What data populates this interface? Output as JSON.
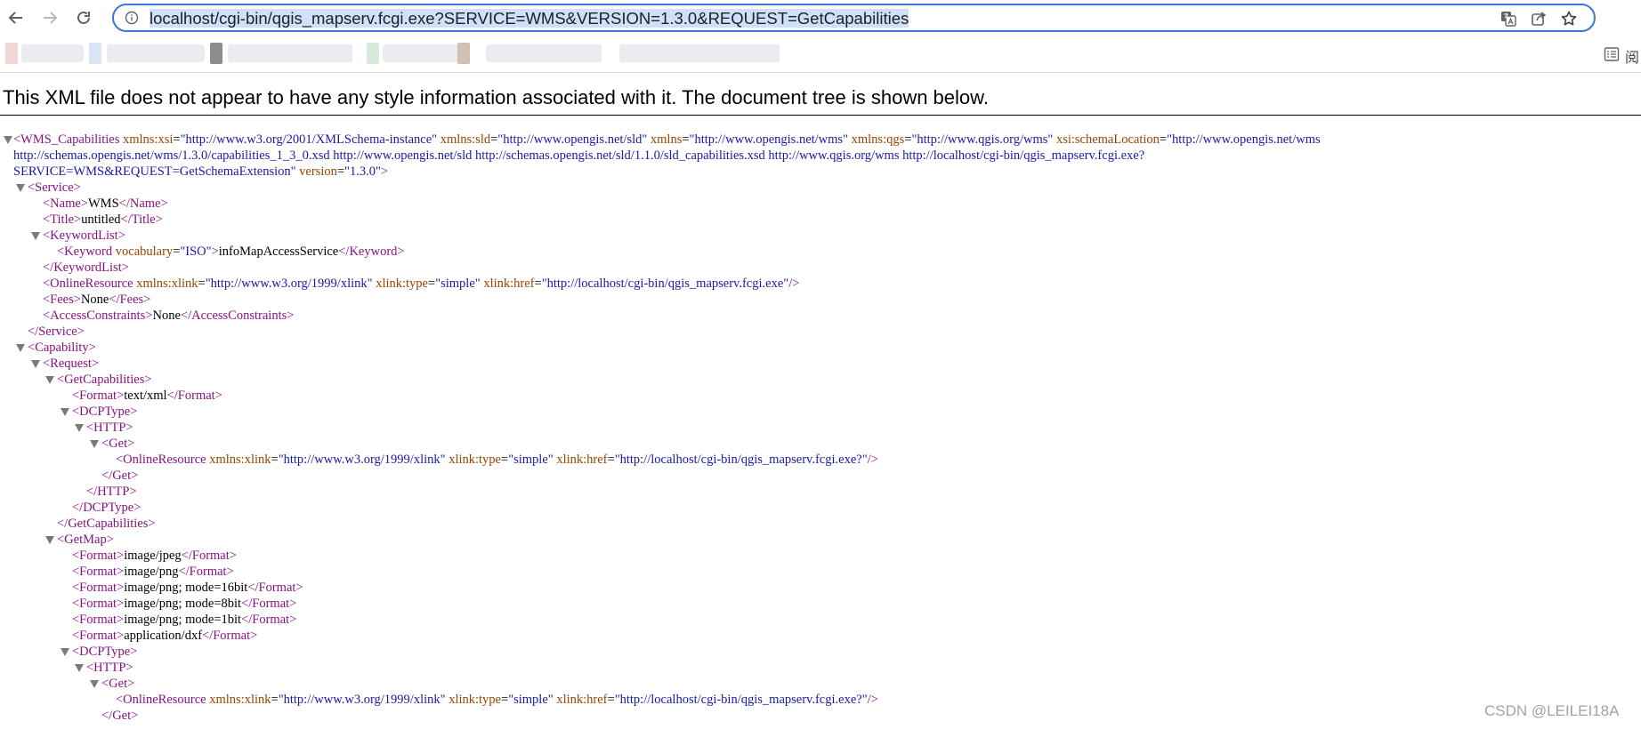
{
  "browser": {
    "url": "localhost/cgi-bin/qgis_mapserv.fcgi.exe?SERVICE=WMS&VERSION=1.3.0&REQUEST=GetCapabilities",
    "reading_list_label": "阅"
  },
  "xml_viewer": {
    "header": "This XML file does not appear to have any style information associated with it. The document tree is shown below.",
    "root_line1": {
      "open": "<WMS_Capabilities",
      "attrs": [
        {
          "n": "xmlns:xsi",
          "v": "\"http://www.w3.org/2001/XMLSchema-instance\""
        },
        {
          "n": "xmlns:sld",
          "v": "\"http://www.opengis.net/sld\""
        },
        {
          "n": "xmlns",
          "v": "\"http://www.opengis.net/wms\""
        },
        {
          "n": "xmlns:qgs",
          "v": "\"http://www.qgis.org/wms\""
        },
        {
          "n": "xsi:schemaLocation",
          "v": "\"http://www.opengis.net/wms"
        }
      ]
    },
    "root_line2": "http://schemas.opengis.net/wms/1.3.0/capabilities_1_3_0.xsd http://www.opengis.net/sld http://schemas.opengis.net/sld/1.1.0/sld_capabilities.xsd http://www.qgis.org/wms http://localhost/cgi-bin/qgis_mapserv.fcgi.exe?",
    "root_line3": {
      "text": "SERVICE=WMS&REQUEST=GetSchemaExtension\"",
      "attr_n": "version",
      "attr_v": "\"1.3.0\"",
      "close": ">"
    },
    "service": {
      "open": "<Service>",
      "close": "</Service>",
      "name": {
        "open": "<Name>",
        "text": "WMS",
        "close": "</Name>"
      },
      "title": {
        "open": "<Title>",
        "text": "untitled",
        "close": "</Title>"
      },
      "keywordlist_open": "<KeywordList>",
      "keyword": {
        "open": "<Keyword",
        "an": "vocabulary",
        "av": "\"ISO\"",
        "gt": ">",
        "text": "infoMapAccessService",
        "close": "</Keyword>"
      },
      "keywordlist_close": "</KeywordList>",
      "online": {
        "open": "<OnlineResource",
        "a1n": "xmlns:xlink",
        "a1v": "\"http://www.w3.org/1999/xlink\"",
        "a2n": "xlink:type",
        "a2v": "\"simple\"",
        "a3n": "xlink:href",
        "a3v": "\"http://localhost/cgi-bin/qgis_mapserv.fcgi.exe\"",
        "close": "/>"
      },
      "fees": {
        "open": "<Fees>",
        "text": "None",
        "close": "</Fees>"
      },
      "access": {
        "open": "<AccessConstraints>",
        "text": "None",
        "close": "</AccessConstraints>"
      }
    },
    "capability": {
      "open": "<Capability>",
      "request_open": "<Request>",
      "getcap_open": "<GetCapabilities>",
      "getcap_format": {
        "open": "<Format>",
        "text": "text/xml",
        "close": "</Format>"
      },
      "dcp_open": "<DCPType>",
      "http_open": "<HTTP>",
      "get_open": "<Get>",
      "online": {
        "open": "<OnlineResource",
        "a1n": "xmlns:xlink",
        "a1v": "\"http://www.w3.org/1999/xlink\"",
        "a2n": "xlink:type",
        "a2v": "\"simple\"",
        "a3n": "xlink:href",
        "a3v": "\"http://localhost/cgi-bin/qgis_mapserv.fcgi.exe?\"",
        "close": "/>"
      },
      "get_close": "</Get>",
      "http_close": "</HTTP>",
      "dcp_close": "</DCPType>",
      "getcap_close": "</GetCapabilities>",
      "getmap_open": "<GetMap>",
      "getmap_formats": [
        "image/jpeg",
        "image/png",
        "image/png; mode=16bit",
        "image/png; mode=8bit",
        "image/png; mode=1bit",
        "application/dxf"
      ],
      "format_open": "<Format>",
      "format_close": "</Format>",
      "getmap_dcp_open": "<DCPType>",
      "getmap_http_open": "<HTTP>",
      "getmap_get_open": "<Get>",
      "getmap_get_close": "</Get>"
    }
  },
  "watermark": "CSDN @LEILEI18A"
}
